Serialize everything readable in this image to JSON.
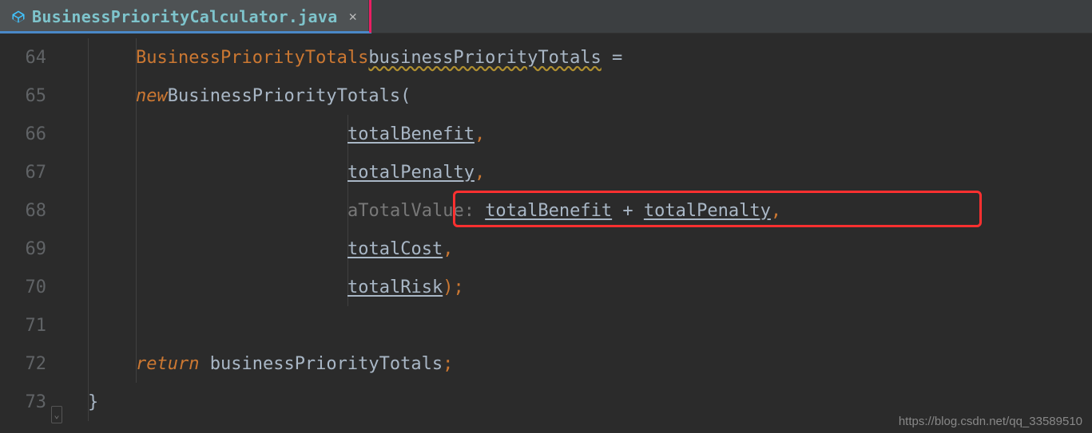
{
  "tab": {
    "filename": "BusinessPriorityCalculator.java"
  },
  "gutter": {
    "lines": [
      "64",
      "65",
      "66",
      "67",
      "68",
      "69",
      "70",
      "71",
      "72",
      "73"
    ]
  },
  "code": {
    "l64": {
      "type": "BusinessPriorityTotals",
      "var": "businessPriorityTotals",
      "eq": " ="
    },
    "l65": {
      "kw": "new",
      "ctor": "BusinessPriorityTotals",
      "paren": "("
    },
    "l66": {
      "arg": "totalBenefit",
      "comma": ","
    },
    "l67": {
      "arg": "totalPenalty",
      "comma": ","
    },
    "l68": {
      "hint": "aTotalValue: ",
      "a": "totalBenefit",
      "plus": " + ",
      "b": "totalPenalty",
      "comma": ","
    },
    "l69": {
      "arg": "totalCost",
      "comma": ","
    },
    "l70": {
      "arg": "totalRisk",
      "close": ");"
    },
    "l72": {
      "kw": "return",
      "expr": " businessPriorityTotals",
      "semi": ";"
    },
    "l73": {
      "brace": "}"
    }
  },
  "watermark": "https://blog.csdn.net/qq_33589510"
}
